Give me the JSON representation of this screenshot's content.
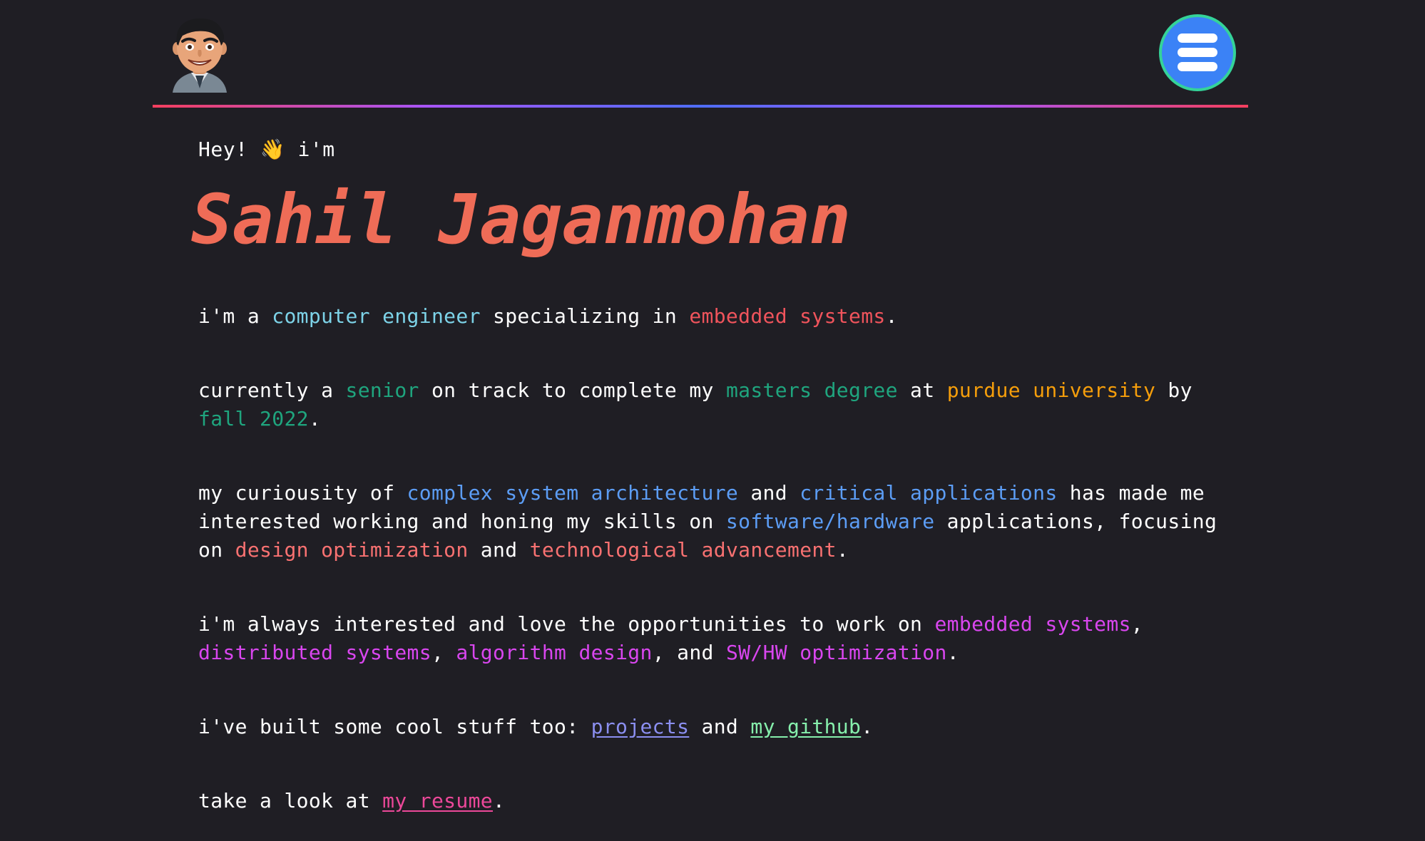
{
  "header": {
    "avatar_icon": "memoji-avatar-icon",
    "menu_icon": "hamburger-menu-icon"
  },
  "intro": {
    "greeting": "Hey! 👋 i'm",
    "name": "Sahil Jaganmohan"
  },
  "paragraphs": {
    "p1": {
      "t1": "i'm a ",
      "h1": "computer engineer",
      "t2": " specializing in ",
      "h2": "embedded systems",
      "t3": "."
    },
    "p2": {
      "t1": "currently a ",
      "h1": "senior",
      "t2": " on track to complete my ",
      "h2": "masters degree",
      "t3": " at ",
      "h3": "purdue university",
      "t4": " by ",
      "h4": "fall 2022",
      "t5": "."
    },
    "p3": {
      "t1": "my curiousity of ",
      "h1": "complex system architecture",
      "t2": " and ",
      "h2": "critical applications",
      "t3": " has made me interested working and honing my skills on ",
      "h3": "software/hardware",
      "t4": " applications, focusing on ",
      "h4": "design optimization",
      "t5": " and ",
      "h5": "technological advancement",
      "t6": "."
    },
    "p4": {
      "t1": "i'm always interested and love the opportunities to work on ",
      "h1": "embedded systems",
      "t2": ", ",
      "h2": "distributed systems",
      "t3": ", ",
      "h3": "algorithm design",
      "t4": ", and ",
      "h4": "SW/HW optimization",
      "t5": "."
    },
    "p5": {
      "t1": "i've built some cool stuff too: ",
      "link1": "projects",
      "t2": " and ",
      "link2": "my github",
      "t3": "."
    },
    "p6": {
      "t1": "take a look at ",
      "link1": "my resume",
      "t2": "."
    }
  },
  "colors": {
    "background": "#1f1e24",
    "name": "#ef6c57",
    "cyan": "#7dd3e8",
    "red": "#f0545c",
    "green": "#1fa57e",
    "orange": "#f59e0b",
    "blue": "#5c9df5",
    "salmon": "#f87171",
    "magenta": "#d946ef",
    "link_projects": "#8b8ff0",
    "link_github": "#86efac",
    "link_resume": "#ec4899",
    "menu_button": "#3b82f6",
    "menu_ring": "#34d399"
  }
}
